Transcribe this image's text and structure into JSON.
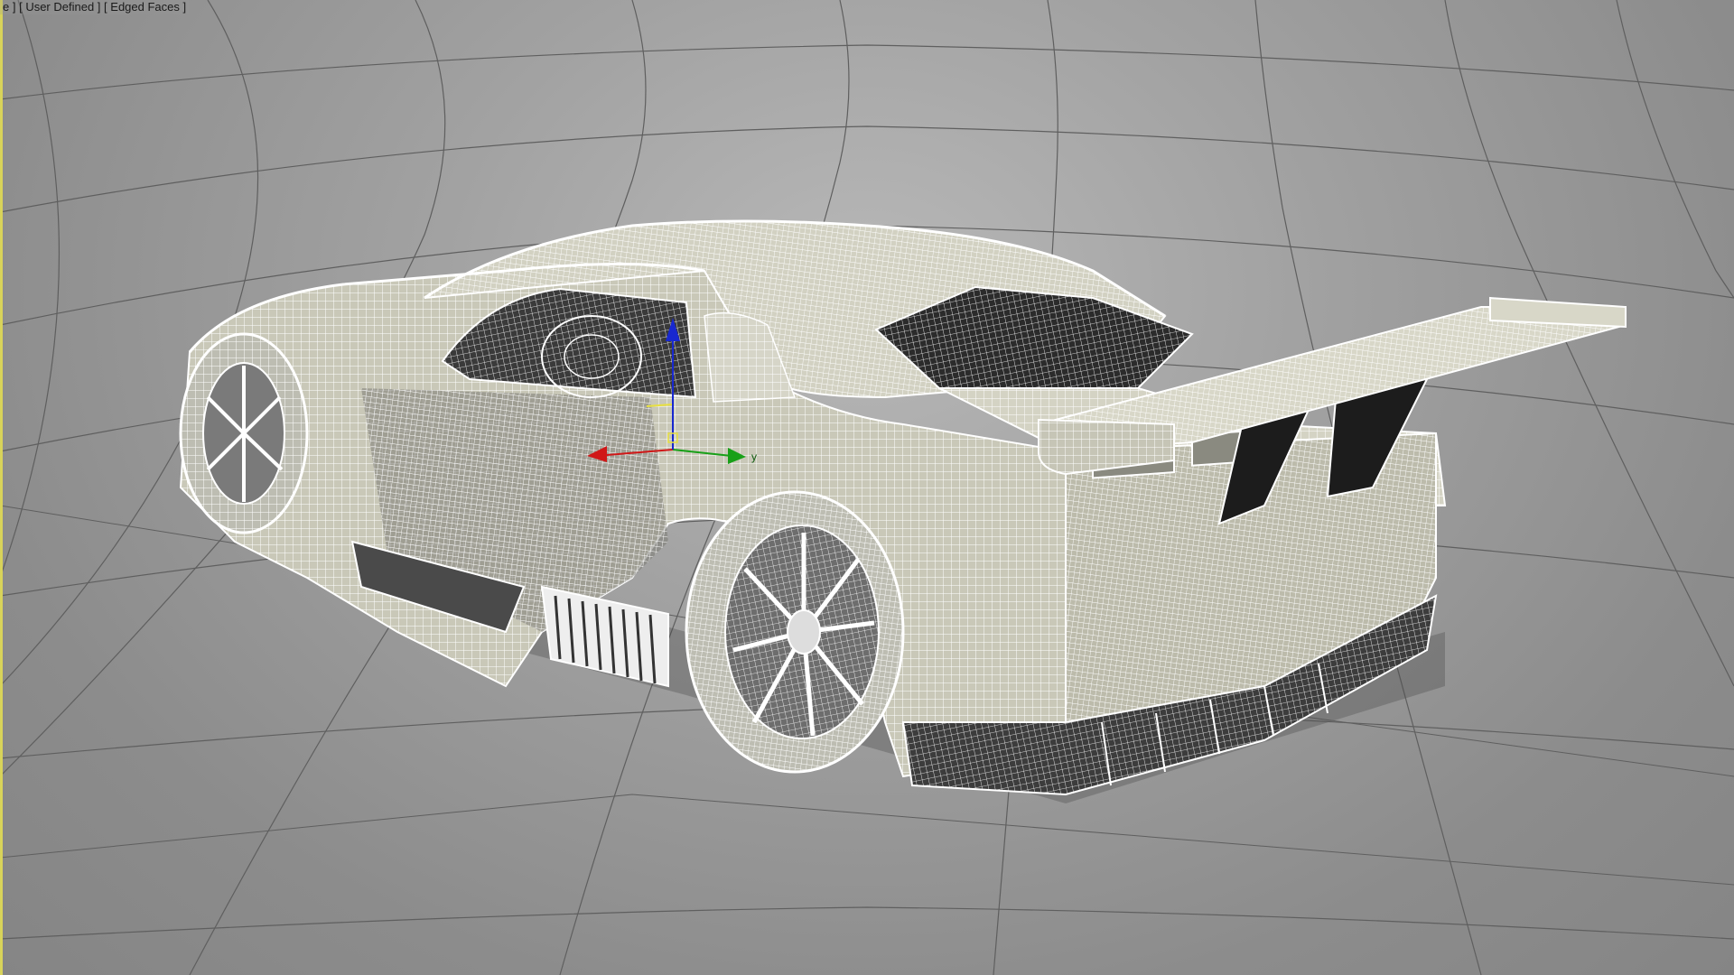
{
  "viewport": {
    "label_parts": [
      "e ]",
      "[ User Defined ]",
      "[ Edged Faces ]"
    ]
  },
  "gizmo": {
    "axes": [
      "x",
      "y",
      "z"
    ],
    "colors": {
      "x": "#d01818",
      "y": "#18a018",
      "z": "#1828d0",
      "frame": "#e8e040"
    },
    "y_label": "y"
  },
  "colors": {
    "background": "#999999",
    "grid": "#5f5f5f",
    "wire": "#ffffff",
    "body_fill": "#c9c8b8"
  }
}
